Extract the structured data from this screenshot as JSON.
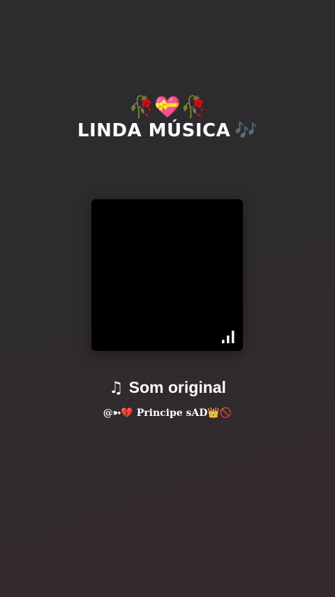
{
  "header": {
    "emoji_line": "🥀💝🥀",
    "title": "LINDA MÚSICA",
    "title_emoji": "🎶"
  },
  "cover": {
    "indicator_icon": "signal-bars-icon",
    "background": "#000000"
  },
  "sound": {
    "icon": "music-note-icon",
    "icon_glyph": "♫",
    "title": "Som original"
  },
  "author": {
    "handle": "@➳💔 Principe sAD👑🚫"
  }
}
